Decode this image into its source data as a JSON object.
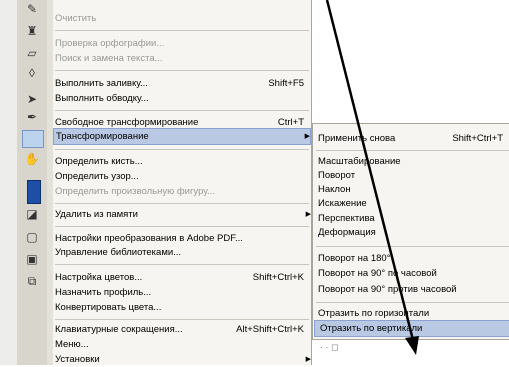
{
  "menu": {
    "items": [
      {
        "label": "Очистить",
        "disabled": true
      },
      {
        "label": "Проверка орфографии...",
        "disabled": true
      },
      {
        "label": "Поиск и замена текста...",
        "disabled": true
      },
      {
        "label": "Выполнить заливку...",
        "shortcut": "Shift+F5"
      },
      {
        "label": "Выполнить обводку..."
      },
      {
        "label": "Свободное трансформирование",
        "shortcut": "Ctrl+T"
      },
      {
        "label": "Трансформирование",
        "submenu": true,
        "highlighted": true
      },
      {
        "label": "Определить кисть..."
      },
      {
        "label": "Определить узор..."
      },
      {
        "label": "Определить произвольную фигуру...",
        "disabled": true
      },
      {
        "label": "Удалить из памяти",
        "submenu": true
      },
      {
        "label": "Настройки преобразования в Adobe PDF..."
      },
      {
        "label": "Управление библиотеками..."
      },
      {
        "label": "Настройка цветов...",
        "shortcut": "Shift+Ctrl+K"
      },
      {
        "label": "Назначить профиль..."
      },
      {
        "label": "Конвертировать цвета..."
      },
      {
        "label": "Клавиатурные сокращения...",
        "shortcut": "Alt+Shift+Ctrl+K"
      },
      {
        "label": "Меню..."
      },
      {
        "label": "Установки",
        "submenu": true
      }
    ]
  },
  "submenu": {
    "items": [
      {
        "label": "Применить снова",
        "shortcut": "Shift+Ctrl+T"
      },
      {
        "label": "Масштабирование"
      },
      {
        "label": "Поворот"
      },
      {
        "label": "Наклон"
      },
      {
        "label": "Искажение"
      },
      {
        "label": "Перспектива"
      },
      {
        "label": "Деформация"
      },
      {
        "label": "Поворот на 180°"
      },
      {
        "label": "Поворот на 90° по часовой"
      },
      {
        "label": "Поворот на 90° против часовой"
      },
      {
        "label": "Отразить по горизонтали"
      },
      {
        "label": "Отразить по вертикали",
        "highlighted": true
      }
    ]
  },
  "tools": [
    "pencil-icon",
    "stamp-icon",
    "eraser-icon",
    "drop-icon",
    "arrow-icon",
    "pen-icon",
    "note-icon",
    "hand-icon",
    "swatch",
    "screen-icon",
    "mask-icon",
    "mode-icon",
    "jump-icon"
  ],
  "colors": {
    "accent_highlight": "#b9c8e3",
    "foreground_swatch": "#1f4ea6",
    "arrow": "#000000"
  }
}
